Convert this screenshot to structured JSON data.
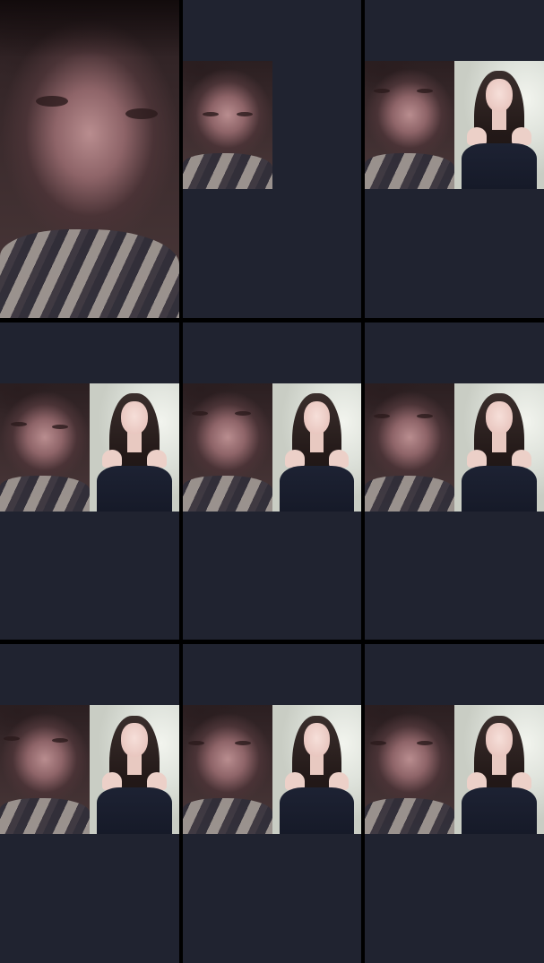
{
  "grid": {
    "rows": 3,
    "columns": 3,
    "background_color": "#000000",
    "cell_color": "#202330"
  },
  "cells": [
    {
      "id": 1,
      "layout": "self-only-large"
    },
    {
      "id": 2,
      "layout": "self-only-small"
    },
    {
      "id": 3,
      "layout": "split"
    },
    {
      "id": 4,
      "layout": "split"
    },
    {
      "id": 5,
      "layout": "split"
    },
    {
      "id": 6,
      "layout": "split"
    },
    {
      "id": 7,
      "layout": "split"
    },
    {
      "id": 8,
      "layout": "split"
    },
    {
      "id": 9,
      "layout": "split"
    }
  ]
}
